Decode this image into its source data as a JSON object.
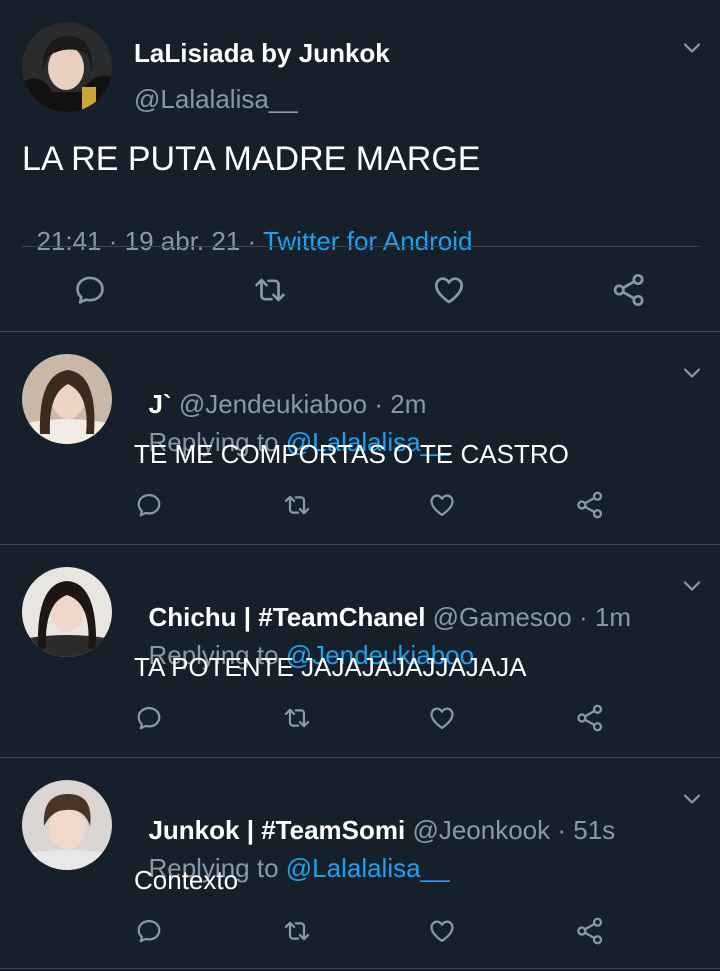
{
  "main_tweet": {
    "display_name": "LaLisiada by Junkok",
    "handle": "@Lalalalisa__",
    "text": "LA RE PUTA MADRE MARGE",
    "time": "21:41",
    "date_sep": " · ",
    "date": "19 abr. 21",
    "source_sep": " · ",
    "source": "Twitter for Android"
  },
  "replies": [
    {
      "display_name": "J`",
      "handle": "@Jendeukiaboo",
      "age": " · 2m",
      "replying_label": "Replying to ",
      "replying_to": "@Lalalalisa__",
      "text": "TE ME COMPORTAS O TE CASTRO"
    },
    {
      "display_name": "Chichu | #TeamChanel",
      "handle": "@Gamesoo",
      "age": " · 1m",
      "replying_label": "Replying to ",
      "replying_to": "@Jendeukiaboo",
      "text": "TA POTENTE JAJAJAJAJJAJAJA"
    },
    {
      "display_name": "Junkok | #TeamSomi",
      "handle": "@Jeonkook",
      "age": " · 51s",
      "replying_label": "Replying to ",
      "replying_to": "@Lalalalisa__",
      "text": "Contexto"
    }
  ],
  "icons": [
    "reply-icon",
    "retweet-icon",
    "like-icon",
    "share-icon",
    "chevron-down-icon"
  ],
  "colors": {
    "background": "#15202b",
    "divider": "#38444d",
    "secondary_text": "#8899a6",
    "link": "#1da1f2"
  }
}
